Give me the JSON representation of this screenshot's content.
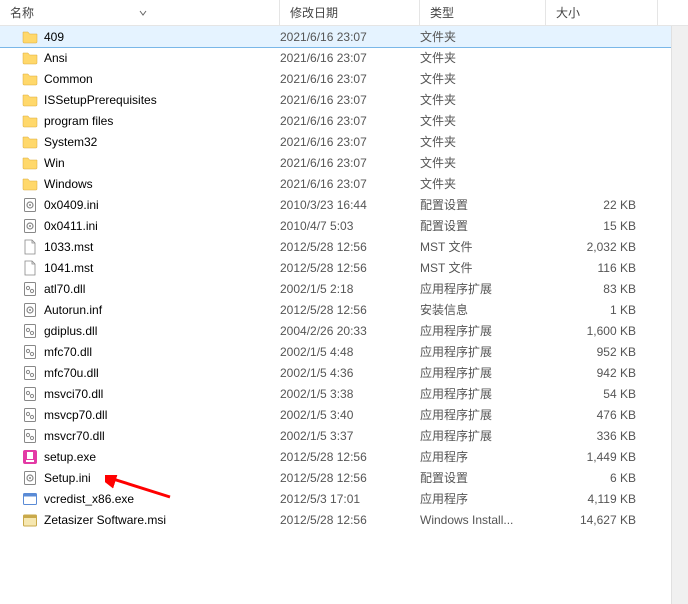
{
  "header": {
    "name": "名称",
    "date": "修改日期",
    "type": "类型",
    "size": "大小"
  },
  "files": [
    {
      "name": "409",
      "date": "2021/6/16 23:07",
      "type": "文件夹",
      "size": "",
      "icon": "folder",
      "selected": true
    },
    {
      "name": "Ansi",
      "date": "2021/6/16 23:07",
      "type": "文件夹",
      "size": "",
      "icon": "folder"
    },
    {
      "name": "Common",
      "date": "2021/6/16 23:07",
      "type": "文件夹",
      "size": "",
      "icon": "folder"
    },
    {
      "name": "ISSetupPrerequisites",
      "date": "2021/6/16 23:07",
      "type": "文件夹",
      "size": "",
      "icon": "folder"
    },
    {
      "name": "program files",
      "date": "2021/6/16 23:07",
      "type": "文件夹",
      "size": "",
      "icon": "folder"
    },
    {
      "name": "System32",
      "date": "2021/6/16 23:07",
      "type": "文件夹",
      "size": "",
      "icon": "folder"
    },
    {
      "name": "Win",
      "date": "2021/6/16 23:07",
      "type": "文件夹",
      "size": "",
      "icon": "folder"
    },
    {
      "name": "Windows",
      "date": "2021/6/16 23:07",
      "type": "文件夹",
      "size": "",
      "icon": "folder"
    },
    {
      "name": "0x0409.ini",
      "date": "2010/3/23 16:44",
      "type": "配置设置",
      "size": "22 KB",
      "icon": "ini"
    },
    {
      "name": "0x0411.ini",
      "date": "2010/4/7 5:03",
      "type": "配置设置",
      "size": "15 KB",
      "icon": "ini"
    },
    {
      "name": "1033.mst",
      "date": "2012/5/28 12:56",
      "type": "MST 文件",
      "size": "2,032 KB",
      "icon": "file"
    },
    {
      "name": "1041.mst",
      "date": "2012/5/28 12:56",
      "type": "MST 文件",
      "size": "116 KB",
      "icon": "file"
    },
    {
      "name": "atl70.dll",
      "date": "2002/1/5 2:18",
      "type": "应用程序扩展",
      "size": "83 KB",
      "icon": "dll"
    },
    {
      "name": "Autorun.inf",
      "date": "2012/5/28 12:56",
      "type": "安装信息",
      "size": "1 KB",
      "icon": "ini"
    },
    {
      "name": "gdiplus.dll",
      "date": "2004/2/26 20:33",
      "type": "应用程序扩展",
      "size": "1,600 KB",
      "icon": "dll"
    },
    {
      "name": "mfc70.dll",
      "date": "2002/1/5 4:48",
      "type": "应用程序扩展",
      "size": "952 KB",
      "icon": "dll"
    },
    {
      "name": "mfc70u.dll",
      "date": "2002/1/5 4:36",
      "type": "应用程序扩展",
      "size": "942 KB",
      "icon": "dll"
    },
    {
      "name": "msvci70.dll",
      "date": "2002/1/5 3:38",
      "type": "应用程序扩展",
      "size": "54 KB",
      "icon": "dll"
    },
    {
      "name": "msvcp70.dll",
      "date": "2002/1/5 3:40",
      "type": "应用程序扩展",
      "size": "476 KB",
      "icon": "dll"
    },
    {
      "name": "msvcr70.dll",
      "date": "2002/1/5 3:37",
      "type": "应用程序扩展",
      "size": "336 KB",
      "icon": "dll"
    },
    {
      "name": "setup.exe",
      "date": "2012/5/28 12:56",
      "type": "应用程序",
      "size": "1,449 KB",
      "icon": "setup"
    },
    {
      "name": "Setup.ini",
      "date": "2012/5/28 12:56",
      "type": "配置设置",
      "size": "6 KB",
      "icon": "ini"
    },
    {
      "name": "vcredist_x86.exe",
      "date": "2012/5/3 17:01",
      "type": "应用程序",
      "size": "4,119 KB",
      "icon": "exe"
    },
    {
      "name": "Zetasizer Software.msi",
      "date": "2012/5/28 12:56",
      "type": "Windows Install...",
      "size": "14,627 KB",
      "icon": "msi"
    }
  ]
}
